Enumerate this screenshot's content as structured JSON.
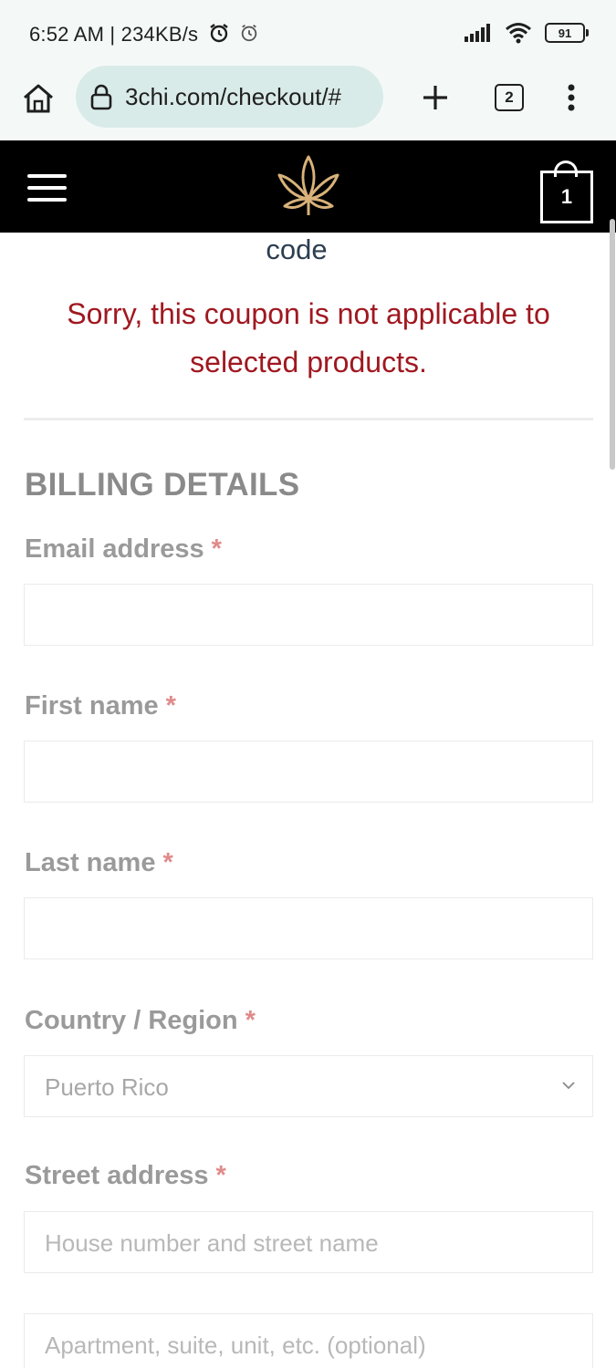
{
  "status_bar": {
    "time": "6:52 AM | 234KB/s",
    "battery": "91"
  },
  "browser": {
    "url": "3chi.com/checkout/#",
    "tab_count": "2"
  },
  "header": {
    "cart_count": "1"
  },
  "coupon": {
    "code_fragment": "code",
    "error_message": "Sorry, this coupon is not applicable to selected products."
  },
  "billing": {
    "title": "BILLING DETAILS",
    "required_marker": "*",
    "email_label": "Email address",
    "first_name_label": "First name",
    "last_name_label": "Last name",
    "country_label": "Country / Region",
    "country_value": "Puerto Rico",
    "street_label": "Street address",
    "street_placeholder": "House number and street name",
    "apartment_placeholder": "Apartment, suite, unit, etc. (optional)"
  },
  "colors": {
    "header_bg": "#000000",
    "error_text": "#a01820",
    "logo_gold": "#d8b27a",
    "browser_bg": "#f4f9f8",
    "url_pill": "#d9ebe8"
  }
}
